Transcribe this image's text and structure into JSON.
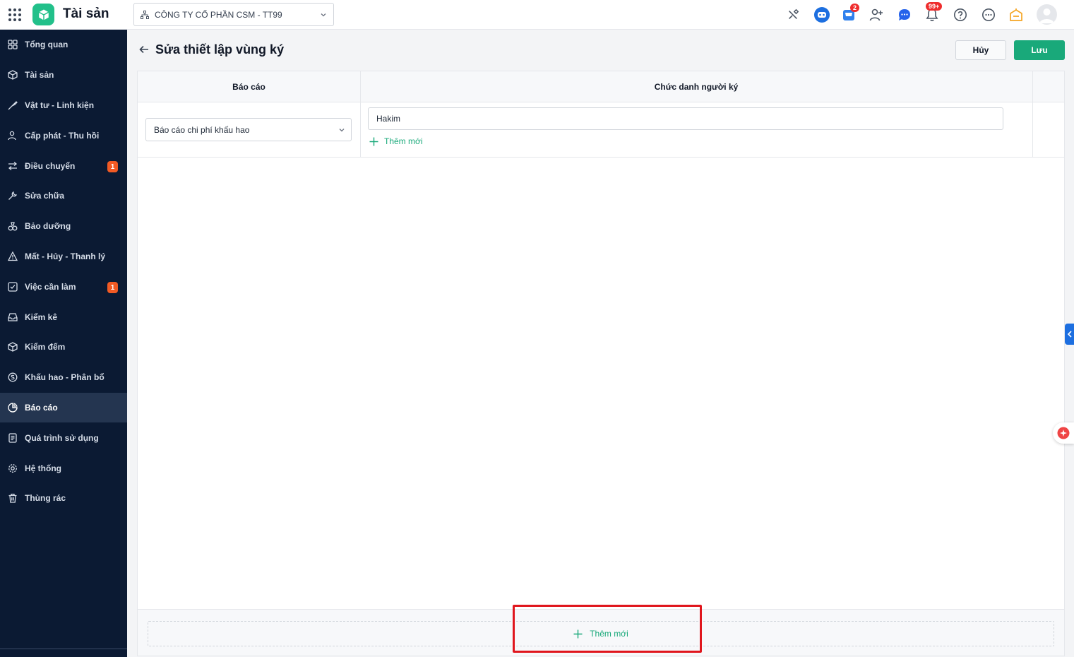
{
  "app": {
    "title": "Tài sản"
  },
  "company": {
    "name": "CÔNG TY CỔ PHẦN CSM - TT99"
  },
  "topbar": {
    "cart_badge": "2",
    "notification_badge": "99+"
  },
  "sidebar": {
    "items": [
      {
        "label": "Tổng quan"
      },
      {
        "label": "Tài sản"
      },
      {
        "label": "Vật tư - Linh kiện"
      },
      {
        "label": "Cấp phát - Thu hồi"
      },
      {
        "label": "Điều chuyển",
        "badge": "1"
      },
      {
        "label": "Sửa chữa"
      },
      {
        "label": "Bảo dưỡng"
      },
      {
        "label": "Mất - Hủy - Thanh lý"
      },
      {
        "label": "Việc cần làm",
        "badge": "1"
      },
      {
        "label": "Kiểm kê"
      },
      {
        "label": "Kiểm đếm"
      },
      {
        "label": "Khấu hao - Phân bổ"
      },
      {
        "label": "Báo cáo",
        "active": true
      },
      {
        "label": "Quá trình sử dụng"
      },
      {
        "label": "Hệ thống"
      },
      {
        "label": "Thùng rác"
      }
    ]
  },
  "page": {
    "title": "Sửa thiết lập vùng ký",
    "cancel_label": "Hủy",
    "save_label": "Lưu"
  },
  "table": {
    "headers": {
      "report": "Báo cáo",
      "signer_title": "Chức danh người ký"
    },
    "rows": [
      {
        "report": "Báo cáo chi phí khấu hao",
        "signer": "Hakim",
        "add_label": "Thêm mới"
      }
    ],
    "add_row_label": "Thêm mới"
  },
  "colors": {
    "accent": "#19a97a",
    "sidebar_bg": "#0b1a33",
    "highlight": "#e0161d"
  }
}
